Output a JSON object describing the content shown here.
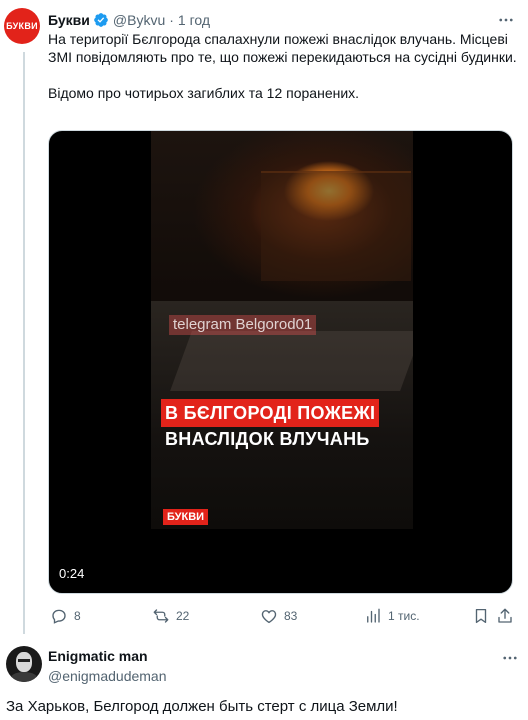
{
  "tweet": {
    "author": {
      "avatar_text": "БУКВИ",
      "display_name": "Букви",
      "handle": "@Bykvu",
      "dot": "·",
      "time": "1 год"
    },
    "text_p1": "На території Бєлгорода спалахнули пожежі внаслідок влучань. Місцеві ЗМІ повідомляють про те, що пожежі перекидаються на сусідні будинки.",
    "text_p2": "Відомо про чотирьох загиблих та 12 поранених.",
    "media": {
      "watermark": "telegram Belgorod01",
      "caption_line1": "В БЄЛГОРОДІ ПОЖЕЖІ",
      "caption_line2": "ВНАСЛІДОК ВЛУЧАНЬ",
      "brand_badge": "БУКВИ",
      "duration": "0:24"
    },
    "stats": {
      "replies": "8",
      "retweets": "22",
      "likes": "83",
      "views": "1 тис."
    }
  },
  "reply": {
    "display_name": "Enigmatic man",
    "handle": "@enigmadudeman",
    "text": "За Харьков, Белгород должен быть стерт с лица Земли!"
  },
  "colors": {
    "brand_red": "#e2231a",
    "verified_blue": "#1d9bf0",
    "secondary_text": "#536471"
  }
}
